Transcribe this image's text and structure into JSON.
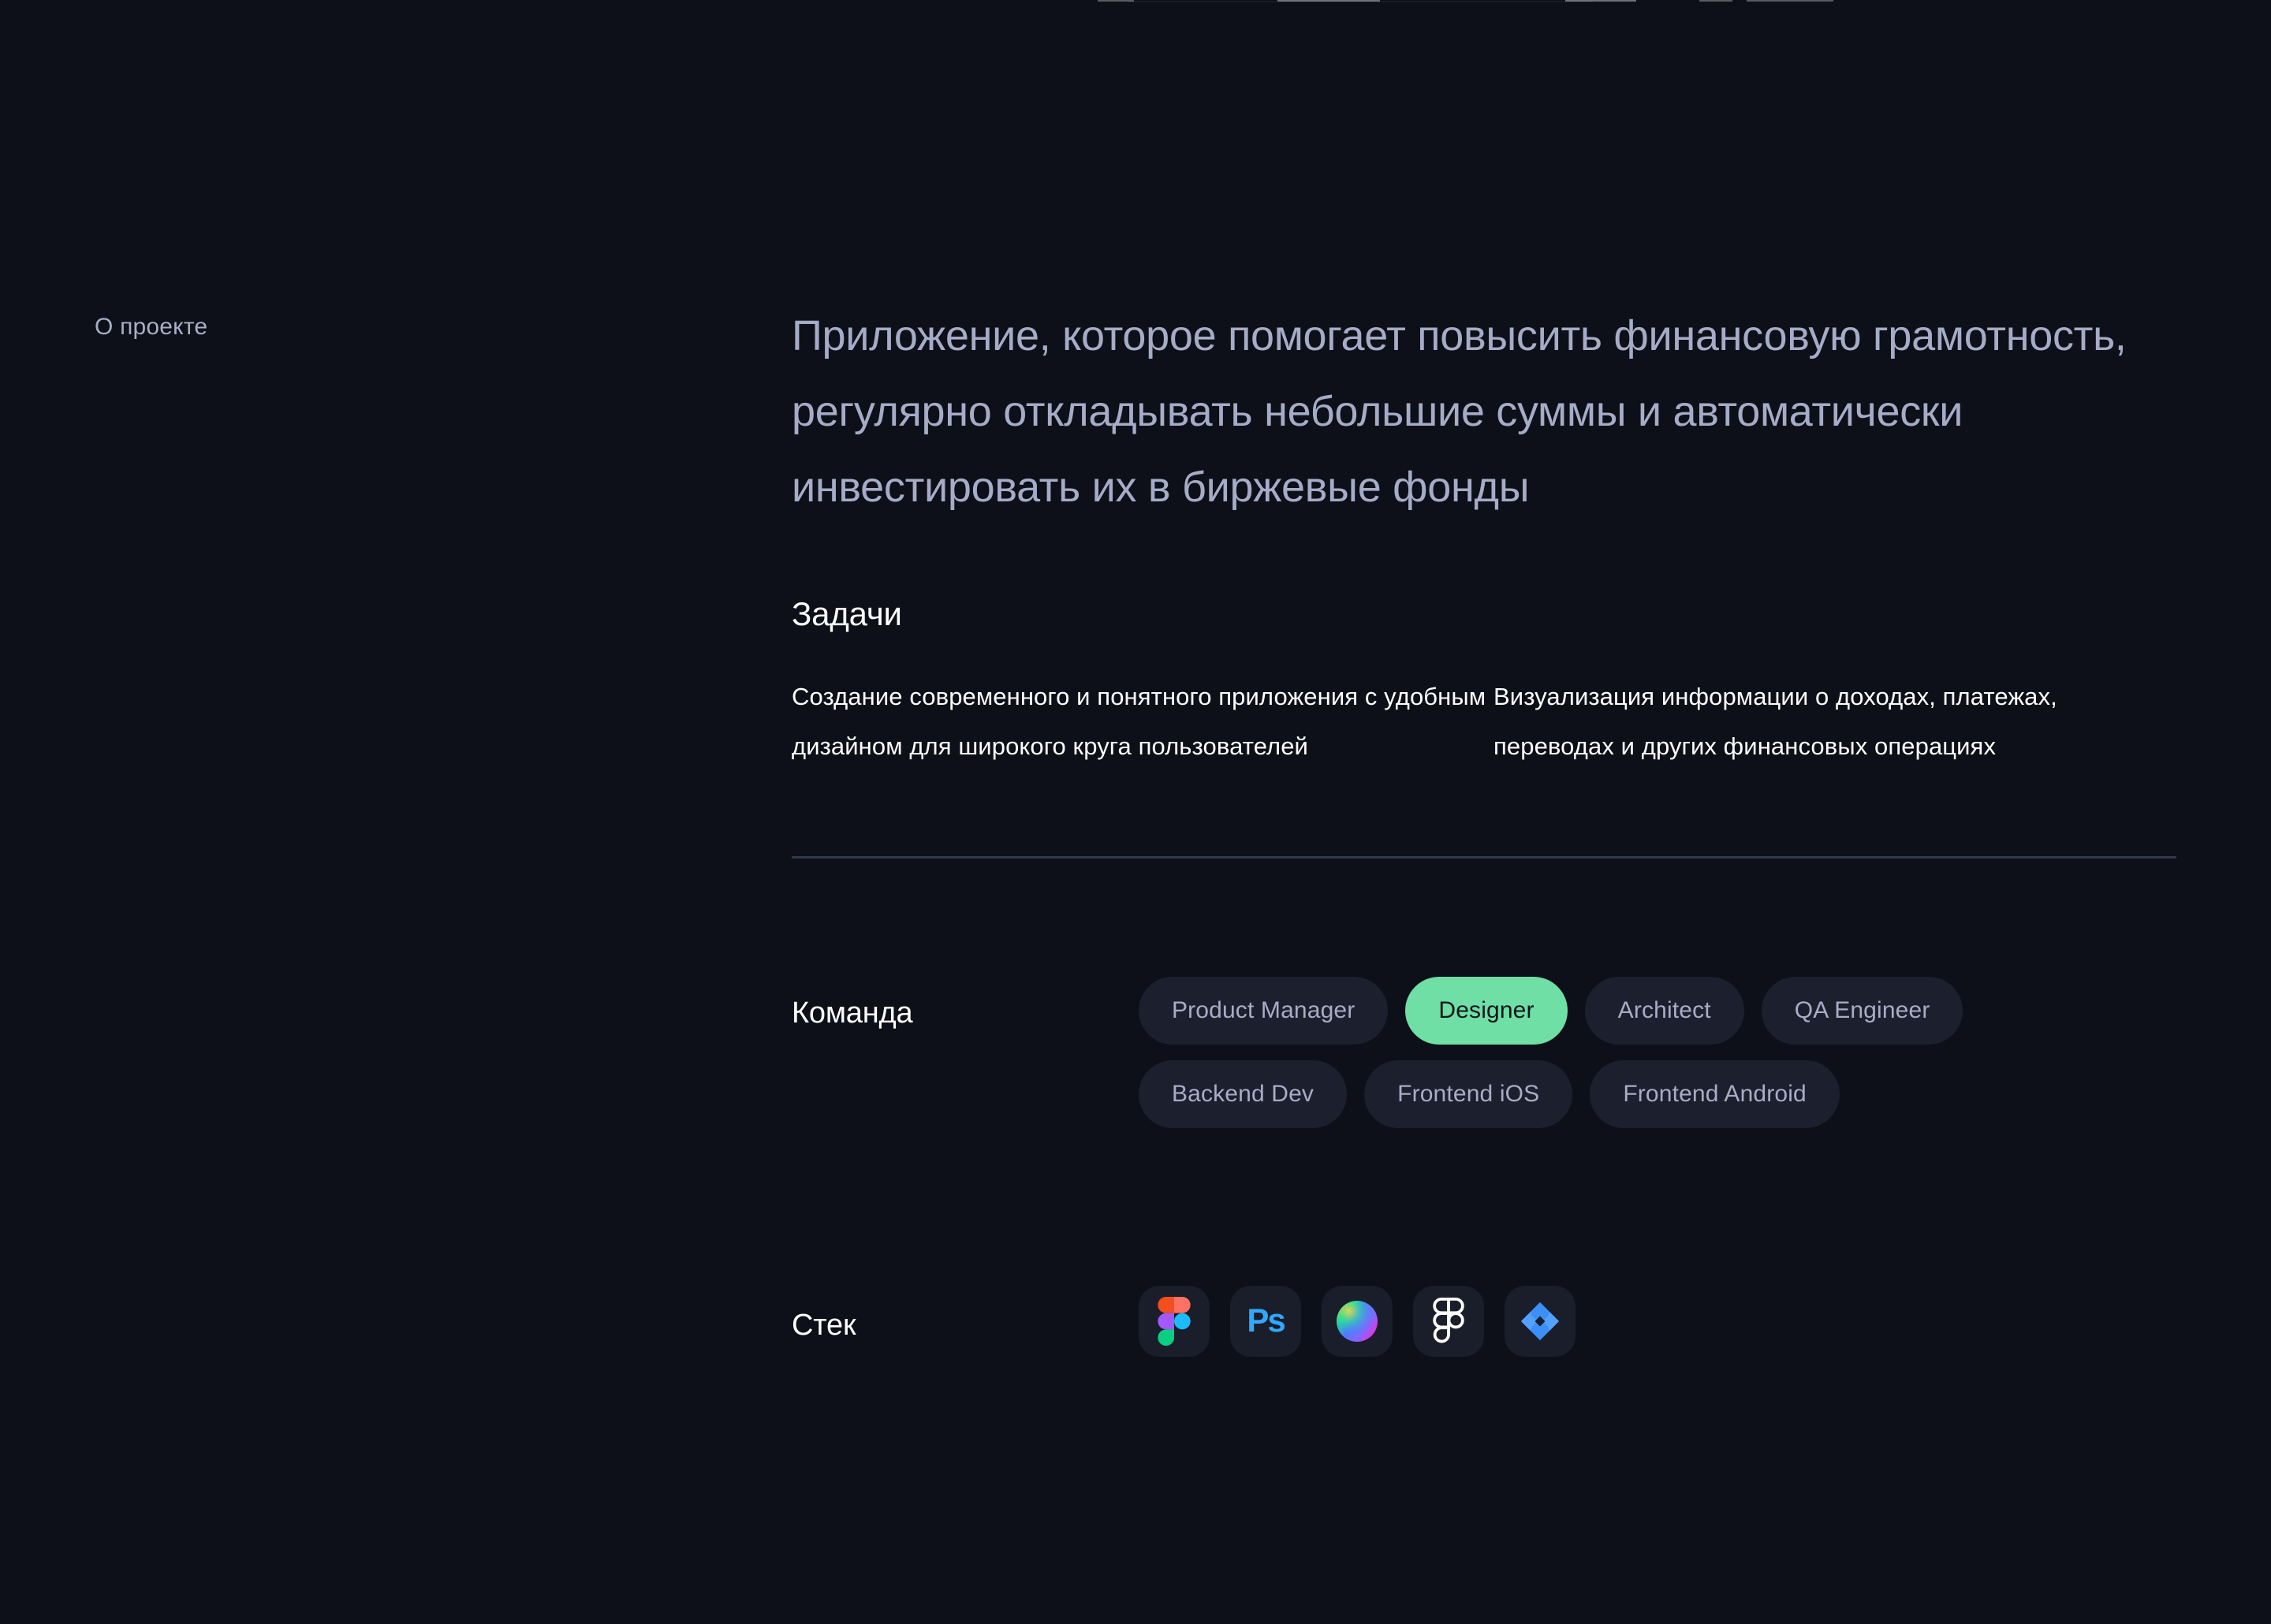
{
  "section": {
    "rail_label": "О проекте",
    "lede": "Приложение, которое помогает повысить финансовую грамотность, регулярно откладывать небольшие суммы и автоматически инвестировать их в биржевые фонды"
  },
  "tasks": {
    "heading": "Задачи",
    "items": [
      "Создание современного и понятного приложения с удобным дизайном для широкого круга пользователей",
      "Визуализация информации о доходах, платежах, переводах и других финансовых операциях"
    ]
  },
  "team": {
    "label": "Команда",
    "members": [
      {
        "label": "Product Manager",
        "active": false
      },
      {
        "label": "Designer",
        "active": true
      },
      {
        "label": "Architect",
        "active": false
      },
      {
        "label": "QA Engineer",
        "active": false
      },
      {
        "label": "Backend Dev",
        "active": false
      },
      {
        "label": "Frontend iOS",
        "active": false
      },
      {
        "label": "Frontend Android",
        "active": false
      }
    ]
  },
  "stack": {
    "label": "Стек",
    "tools": [
      {
        "name": "figma-icon",
        "title": "Figma"
      },
      {
        "name": "photoshop-icon",
        "title": "Adobe Photoshop"
      },
      {
        "name": "spline-icon",
        "title": "Spline"
      },
      {
        "name": "figjam-icon",
        "title": "FigJam"
      },
      {
        "name": "jira-icon",
        "title": "Jira"
      }
    ]
  },
  "colors": {
    "background": "#0d1018",
    "accent_green": "#6fdfa5",
    "pill_background": "#1c1f2e",
    "muted_text": "#a8adc6",
    "primary_text": "#ffffff",
    "lede_text": "#a6abc7",
    "divider": "#3b3f55",
    "tile_background": "#1a1d2a"
  }
}
